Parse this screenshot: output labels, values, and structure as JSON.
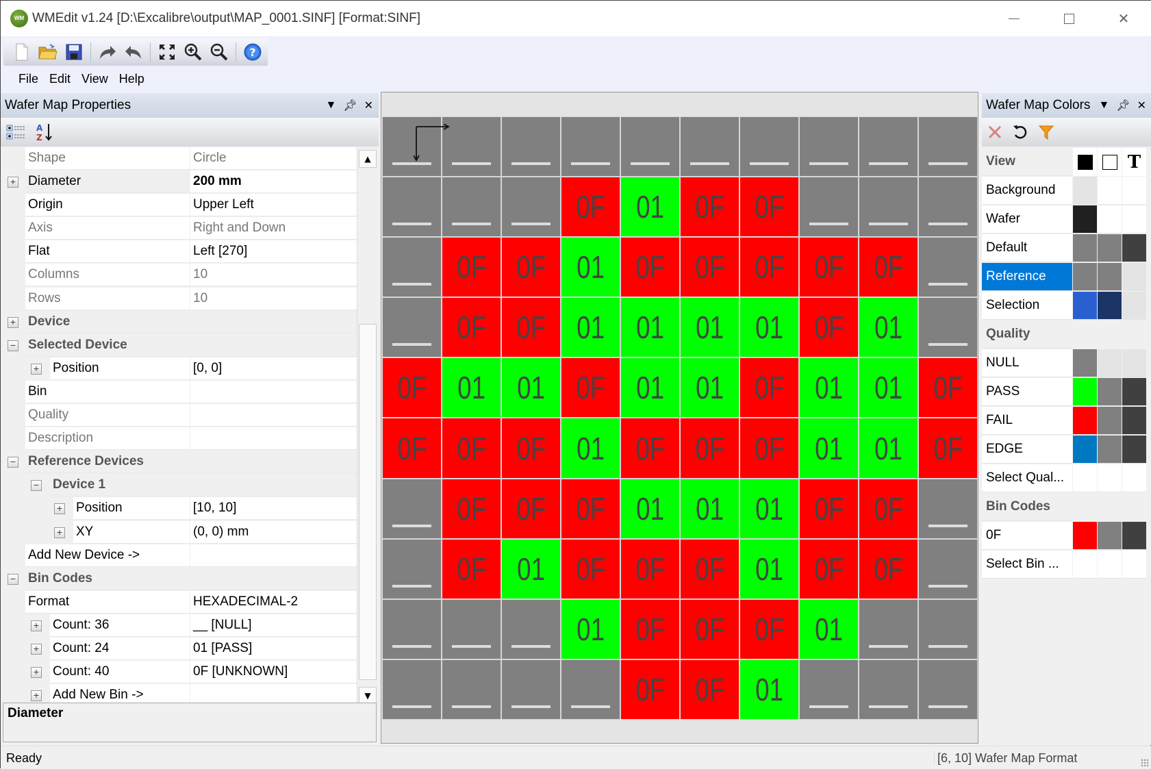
{
  "window": {
    "logo_text": "WM",
    "title": "WMEdit v1.24 [D:\\Excalibre\\output\\MAP_0001.SINF] [Format:SINF]",
    "controls": [
      "minimize",
      "maximize",
      "close"
    ]
  },
  "toolbar": {
    "buttons": [
      "new-file",
      "open-folder",
      "save",
      "redo",
      "undo",
      "fit-to-screen",
      "zoom-in",
      "zoom-out",
      "help"
    ]
  },
  "menu": [
    "File",
    "Edit",
    "View",
    "Help"
  ],
  "properties_panel": {
    "title": "Wafer Map Properties",
    "rows": [
      {
        "name": "Shape",
        "value": "Circle",
        "kind": "prop",
        "disabled": true
      },
      {
        "name": "Diameter",
        "value": "200 mm",
        "kind": "prop",
        "expander": "+",
        "bold_value": true,
        "highlight": true
      },
      {
        "name": "Origin",
        "value": "Upper Left",
        "kind": "prop"
      },
      {
        "name": "Axis",
        "value": "Right and Down",
        "kind": "prop",
        "disabled": true
      },
      {
        "name": "Flat",
        "value": "Left [270]",
        "kind": "prop"
      },
      {
        "name": "Columns",
        "value": "10",
        "kind": "prop",
        "disabled": true
      },
      {
        "name": "Rows",
        "value": "10",
        "kind": "prop",
        "disabled": true
      },
      {
        "name": "Device",
        "kind": "category",
        "expander": "+"
      },
      {
        "name": "Selected Device",
        "kind": "category",
        "expander": "−"
      },
      {
        "name": "Position",
        "value": "[0, 0]",
        "kind": "prop",
        "level": 1,
        "expander": "+"
      },
      {
        "name": "Bin",
        "value": "",
        "kind": "prop"
      },
      {
        "name": "Quality",
        "value": "",
        "kind": "prop",
        "disabled": true
      },
      {
        "name": "Description",
        "value": "",
        "kind": "prop",
        "disabled": true
      },
      {
        "name": "Reference Devices",
        "kind": "category",
        "expander": "−"
      },
      {
        "name": "Device 1",
        "kind": "category",
        "level": 1,
        "expander": "−"
      },
      {
        "name": "Position",
        "value": "[10, 10]",
        "kind": "prop",
        "level": 2,
        "expander": "+"
      },
      {
        "name": "XY",
        "value": "(0, 0) mm",
        "kind": "prop",
        "level": 2,
        "expander": "+"
      },
      {
        "name": "Add New Device ->",
        "value": "",
        "kind": "prop"
      },
      {
        "name": "Bin Codes",
        "kind": "category",
        "expander": "−"
      },
      {
        "name": "Format",
        "value": "HEXADECIMAL-2",
        "kind": "prop"
      },
      {
        "name": "Count: 36",
        "value": "__ [NULL]",
        "kind": "prop",
        "level": 1,
        "expander": "+"
      },
      {
        "name": "Count: 24",
        "value": "01 [PASS]",
        "kind": "prop",
        "level": 1,
        "expander": "+"
      },
      {
        "name": "Count: 40",
        "value": "0F [UNKNOWN]",
        "kind": "prop",
        "level": 1,
        "expander": "+"
      },
      {
        "name": "Add New Bin ->",
        "value": "",
        "kind": "prop",
        "level": 1,
        "expander": "+"
      }
    ],
    "description_title": "Diameter"
  },
  "wafer_map": {
    "columns": 10,
    "rows": 10,
    "bins": {
      "__": {
        "label": "__",
        "quality": "NULL",
        "color": "#808080"
      },
      "01": {
        "label": "01",
        "quality": "PASS",
        "color": "#00ff00"
      },
      "0F": {
        "label": "0F",
        "quality": "FAIL",
        "color": "#ff0000"
      }
    },
    "grid": [
      [
        "__",
        "__",
        "__",
        "__",
        "__",
        "__",
        "__",
        "__",
        "__",
        "__"
      ],
      [
        "__",
        "__",
        "__",
        "0F",
        "01",
        "0F",
        "0F",
        "__",
        "__",
        "__"
      ],
      [
        "__",
        "0F",
        "0F",
        "01",
        "0F",
        "0F",
        "0F",
        "0F",
        "0F",
        "__"
      ],
      [
        "__",
        "0F",
        "0F",
        "01",
        "01",
        "01",
        "01",
        "0F",
        "01",
        "__"
      ],
      [
        "0F",
        "01",
        "01",
        "0F",
        "01",
        "01",
        "0F",
        "01",
        "01",
        "0F"
      ],
      [
        "0F",
        "0F",
        "0F",
        "01",
        "0F",
        "0F",
        "0F",
        "01",
        "01",
        "0F"
      ],
      [
        "__",
        "0F",
        "0F",
        "0F",
        "01",
        "01",
        "01",
        "0F",
        "0F",
        "__"
      ],
      [
        "__",
        "0F",
        "01",
        "0F",
        "0F",
        "0F",
        "01",
        "0F",
        "0F",
        "__"
      ],
      [
        "__",
        "__",
        "__",
        "01",
        "0F",
        "0F",
        "0F",
        "01",
        "__",
        "__"
      ],
      [
        "__",
        "__",
        "__",
        "__",
        "0F",
        "0F",
        "01",
        "__",
        "__",
        "__"
      ]
    ],
    "text_color": "#444444",
    "null_marker_color": "#dcdcdc"
  },
  "colors_panel": {
    "title": "Wafer Map Colors",
    "toolbar": [
      "delete",
      "reset",
      "filter"
    ],
    "column_headers": [
      "fill",
      "border",
      "text"
    ],
    "rows": [
      {
        "label": "View",
        "kind": "category"
      },
      {
        "label": "Background",
        "swatches": [
          "#e4e4e4",
          "#ffffff",
          "#ffffff"
        ]
      },
      {
        "label": "Wafer",
        "swatches": [
          "#202020",
          "#ffffff",
          "#ffffff"
        ]
      },
      {
        "label": "Default",
        "swatches": [
          "#808080",
          "#808080",
          "#404040"
        ]
      },
      {
        "label": "Reference",
        "swatches": [
          "#808080",
          "#808080",
          "#e4e4e4"
        ],
        "selected": true
      },
      {
        "label": "Selection",
        "swatches": [
          "#2a5fd0",
          "#1b3566",
          "#e4e4e4"
        ]
      },
      {
        "label": "Quality",
        "kind": "category"
      },
      {
        "label": "NULL",
        "swatches": [
          "#808080",
          "#e4e4e4",
          "#e4e4e4"
        ]
      },
      {
        "label": "PASS",
        "swatches": [
          "#00ff00",
          "#808080",
          "#404040"
        ]
      },
      {
        "label": "FAIL",
        "swatches": [
          "#ff0000",
          "#808080",
          "#404040"
        ]
      },
      {
        "label": "EDGE",
        "swatches": [
          "#0078c0",
          "#808080",
          "#404040"
        ]
      },
      {
        "label": "Select Qual...",
        "swatches": [
          "#ffffff",
          "#ffffff",
          "#ffffff"
        ]
      },
      {
        "label": "Bin Codes",
        "kind": "category"
      },
      {
        "label": "0F",
        "swatches": [
          "#ff0000",
          "#808080",
          "#404040"
        ]
      },
      {
        "label": "Select Bin ...",
        "swatches": [
          "#ffffff",
          "#ffffff",
          "#ffffff"
        ]
      }
    ]
  },
  "status": {
    "left": "Ready",
    "right": "[6, 10] Wafer Map Format"
  }
}
